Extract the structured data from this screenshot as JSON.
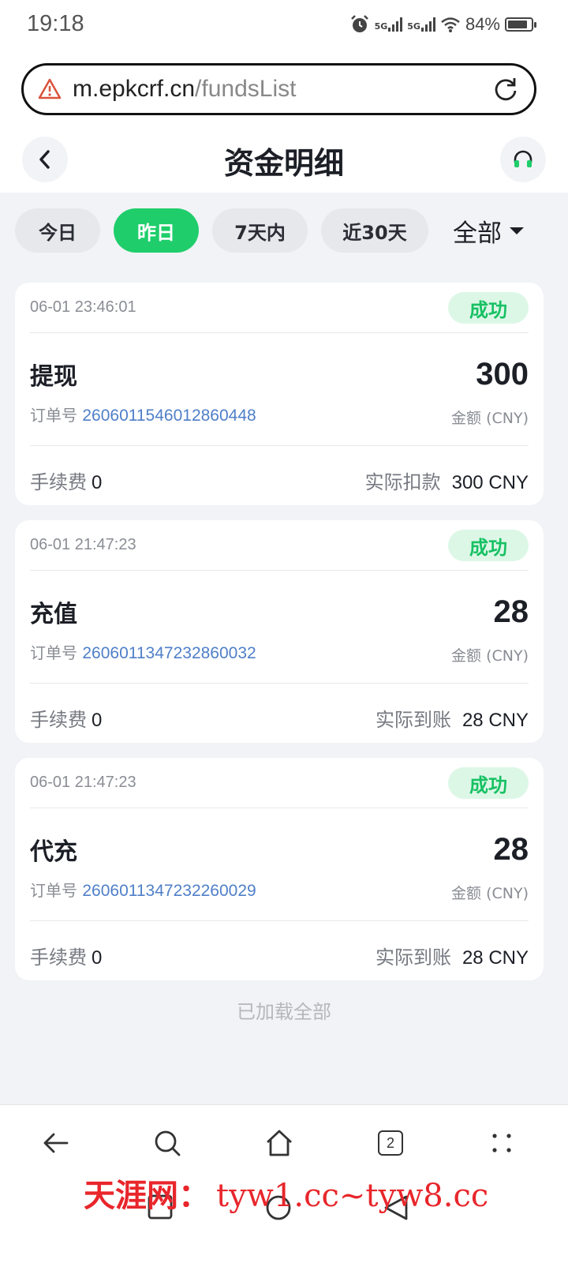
{
  "status_bar": {
    "time": "19:18",
    "network": [
      "5G",
      "5G"
    ],
    "battery": "84%",
    "battery_level": 0.84,
    "icons": [
      "alarm-icon",
      "signal-icon",
      "wifi-icon",
      "battery-icon"
    ]
  },
  "browser": {
    "url_host": "m.epkcrf.cn",
    "url_path": "/fundsList",
    "tab_count": "2",
    "icons": [
      "warning-icon",
      "reload-icon",
      "back-arrow-icon",
      "search-icon",
      "home-icon",
      "tabs-icon",
      "menu-dots-icon"
    ]
  },
  "header": {
    "title": "资金明细",
    "icons": [
      "chevron-left-icon",
      "headset-icon"
    ]
  },
  "filters": {
    "chips": [
      {
        "label": "今日",
        "active": false
      },
      {
        "label": "昨日",
        "active": true
      },
      {
        "label": "7天内",
        "active": false
      },
      {
        "label": "近30天",
        "active": false
      }
    ],
    "dropdown_label": "全部"
  },
  "records": [
    {
      "time": "06-01 23:46:01",
      "status": "成功",
      "type": "提现",
      "order_label": "订单号",
      "order_no": "2606011546012860448",
      "amount": "300",
      "amount_label": "金额 (CNY)",
      "fee_label": "手续费",
      "fee": "0",
      "actual_label": "实际扣款",
      "actual_value": "300 CNY"
    },
    {
      "time": "06-01 21:47:23",
      "status": "成功",
      "type": "充值",
      "order_label": "订单号",
      "order_no": "2606011347232860032",
      "amount": "28",
      "amount_label": "金额 (CNY)",
      "fee_label": "手续费",
      "fee": "0",
      "actual_label": "实际到账",
      "actual_value": "28 CNY"
    },
    {
      "time": "06-01 21:47:23",
      "status": "成功",
      "type": "代充",
      "order_label": "订单号",
      "order_no": "2606011347232260029",
      "amount": "28",
      "amount_label": "金额 (CNY)",
      "fee_label": "手续费",
      "fee": "0",
      "actual_label": "实际到账",
      "actual_value": "28 CNY"
    }
  ],
  "footer_text": "已加载全部",
  "watermark": {
    "site_name": "天涯网：",
    "urls": "tyw1.cc~tyw8.cc"
  },
  "colors": {
    "accent": "#1fce6b",
    "success_badge_bg": "#ddf7e7",
    "success_text": "#17c163",
    "order_link": "#4f7fc8",
    "watermark": "#e8262b",
    "page_bg": "#f1f3f6"
  }
}
